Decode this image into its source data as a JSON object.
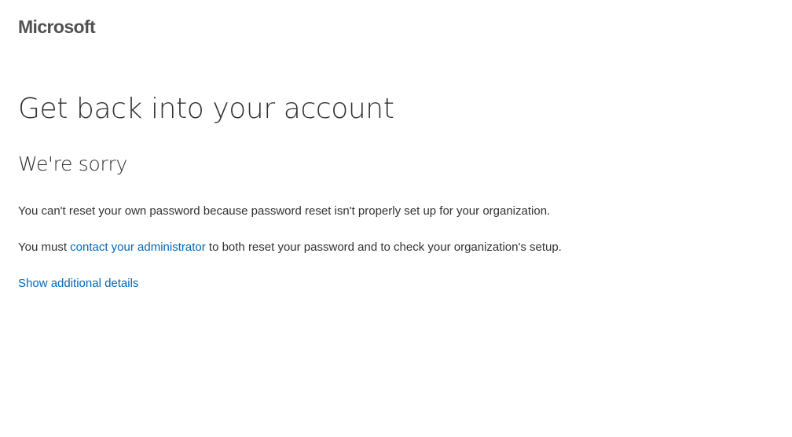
{
  "brand": {
    "logo_text": "Microsoft"
  },
  "main": {
    "title": "Get back into your account",
    "subtitle": "We're sorry",
    "message_1": "You can't reset your own password because password reset isn't properly set up for your organization.",
    "message_2_prefix": "You must ",
    "message_2_link": "contact your administrator",
    "message_2_suffix": " to both reset your password and to check your organization's setup.",
    "details_link": "Show additional details"
  },
  "colors": {
    "link": "#0067b8",
    "text": "#323130",
    "logo": "#505050",
    "background": "#ffffff"
  }
}
